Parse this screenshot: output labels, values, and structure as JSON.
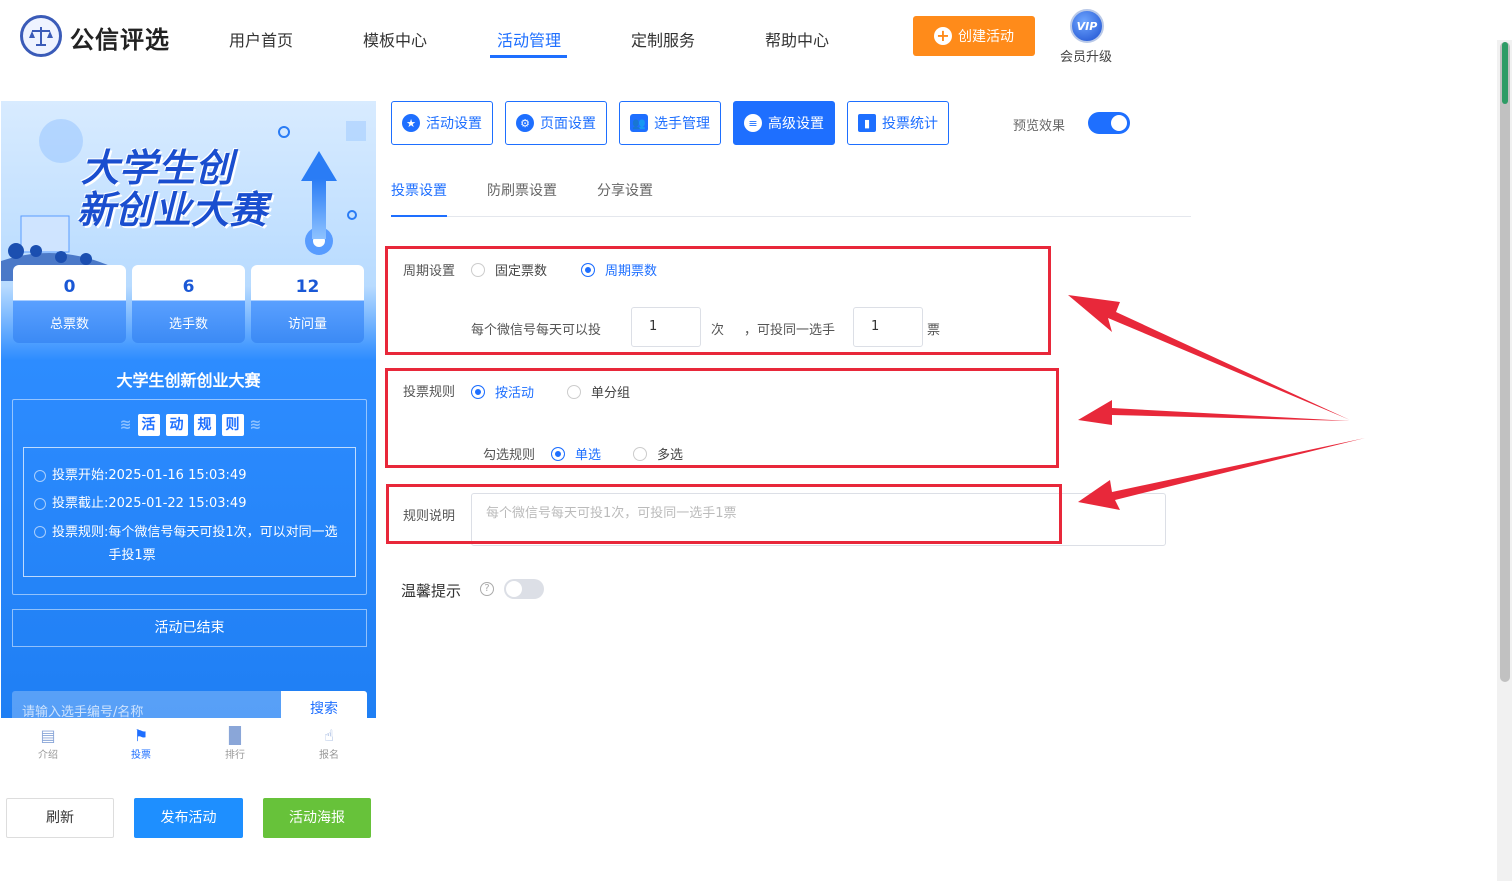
{
  "brand": {
    "name": "公信评选"
  },
  "nav": {
    "items": [
      "用户首页",
      "模板中心",
      "活动管理",
      "定制服务",
      "帮助中心"
    ],
    "active_index": 2
  },
  "header": {
    "create_label": "创建活动",
    "vip_badge": "VIP",
    "vip_label": "会员升级"
  },
  "preview": {
    "banner_title_line1": "大学生创",
    "banner_title_line2": "新创业大赛",
    "stats": [
      {
        "value": "0",
        "label": "总票数"
      },
      {
        "value": "6",
        "label": "选手数"
      },
      {
        "value": "12",
        "label": "访问量"
      }
    ],
    "title": "大学生创新创业大赛",
    "rules_heading": [
      "活",
      "动",
      "规",
      "则"
    ],
    "rules": [
      {
        "label": "投票开始:",
        "value": "2025-01-16 15:03:49"
      },
      {
        "label": "投票截止:",
        "value": "2025-01-22 15:03:49"
      },
      {
        "label": "投票规则:",
        "value": "每个微信号每天可投1次，可以对同一选手投1票"
      }
    ],
    "ended": "活动已结束",
    "search_placeholder": "请输入选手编号/名称",
    "search_button": "搜索",
    "tabs": [
      "介绍",
      "投票",
      "排行",
      "报名"
    ],
    "active_tab": 1
  },
  "actions": {
    "refresh": "刷新",
    "publish": "发布活动",
    "poster": "活动海报"
  },
  "toolbar": {
    "buttons": [
      "活动设置",
      "页面设置",
      "选手管理",
      "高级设置",
      "投票统计"
    ],
    "active_index": 3,
    "preview_label": "预览效果",
    "preview_on": true
  },
  "subtabs": {
    "items": [
      "投票设置",
      "防刷票设置",
      "分享设置"
    ],
    "active_index": 0
  },
  "form": {
    "cycle_label": "周期设置",
    "cycle_options": [
      "固定票数",
      "周期票数"
    ],
    "cycle_selected": 1,
    "per_day_label": "每个微信号每天可以投",
    "per_day_value": "1",
    "per_day_unit": "次",
    "same_player_label": "，可投同一选手",
    "same_player_value": "1",
    "same_player_unit": "票",
    "rule_label": "投票规则",
    "rule_options": [
      "按活动",
      "单分组"
    ],
    "rule_selected": 0,
    "check_label": "勾选规则",
    "check_options": [
      "单选",
      "多选"
    ],
    "check_selected": 0,
    "desc_label": "规则说明",
    "desc_placeholder": "每个微信号每天可投1次，可投同一选手1票",
    "tip_label": "温馨提示",
    "tip_help": "?",
    "tip_on": false
  },
  "colors": {
    "accent": "#1e6fff",
    "orange": "#ff8b1a",
    "green": "#67c23a",
    "highlight_red": "#e8283a"
  }
}
